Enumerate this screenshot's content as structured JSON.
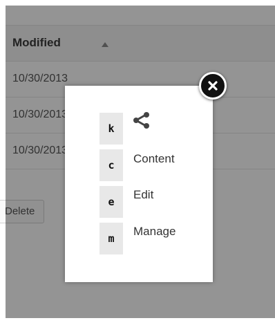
{
  "table": {
    "column_header": "Modified",
    "sort_icon": "sort-ascending-icon",
    "rows": [
      "10/30/2013",
      "10/30/2013",
      "10/30/2013"
    ],
    "delete_label": "Delete"
  },
  "dialog": {
    "close_icon": "close-icon",
    "shortcuts": [
      {
        "key": "k",
        "label": "",
        "icon": "share-icon"
      },
      {
        "key": "c",
        "label": "Content"
      },
      {
        "key": "e",
        "label": "Edit"
      },
      {
        "key": "m",
        "label": "Manage"
      }
    ]
  },
  "colors": {
    "overlay": "#00000069",
    "key_background": "#e8e8e8",
    "close_button": "#111111"
  }
}
